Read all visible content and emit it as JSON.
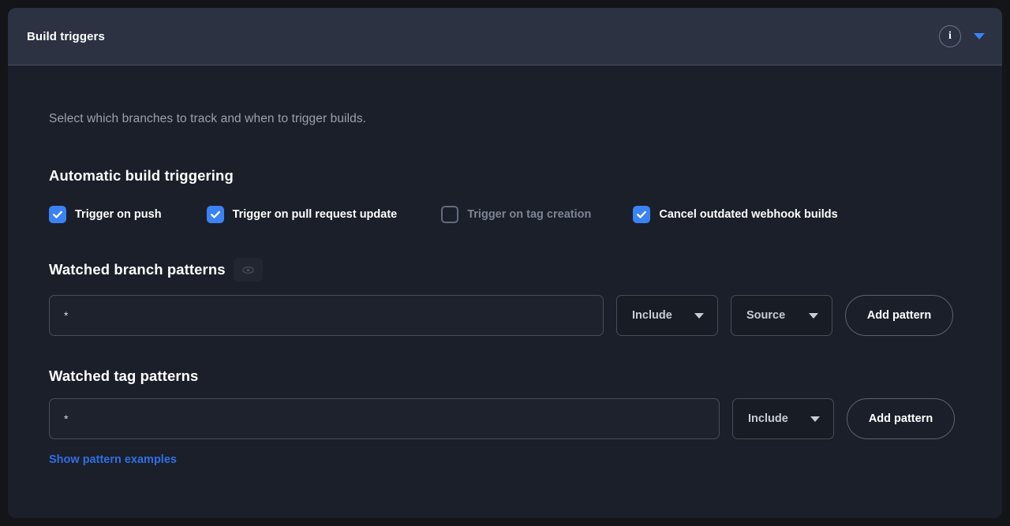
{
  "header": {
    "title": "Build triggers",
    "info_icon": "info-icon",
    "collapse_icon": "chevron-down-icon"
  },
  "body": {
    "intro": "Select which branches to track and when to trigger builds.",
    "automatic_section": {
      "heading": "Automatic build triggering",
      "checkboxes": [
        {
          "label": "Trigger on push",
          "checked": true,
          "disabled": false
        },
        {
          "label": "Trigger on pull request update",
          "checked": true,
          "disabled": false
        },
        {
          "label": "Trigger on tag creation",
          "checked": false,
          "disabled": true
        },
        {
          "label": "Cancel outdated webhook builds",
          "checked": true,
          "disabled": false
        }
      ]
    },
    "branch_section": {
      "heading": "Watched branch patterns",
      "visibility_icon": "eye-icon",
      "input_value": "*",
      "input_placeholder": "*",
      "include_select": "Include",
      "source_select": "Source",
      "add_button": "Add pattern"
    },
    "tag_section": {
      "heading": "Watched tag patterns",
      "input_value": "*",
      "input_placeholder": "*",
      "include_select": "Include",
      "add_button": "Add pattern",
      "examples_link": "Show pattern examples"
    }
  },
  "colors": {
    "page_background": "#141519",
    "card_background": "#1b1f29",
    "header_background": "#2c3242",
    "accent_blue": "#3b82f6",
    "link_blue": "#2f6fe4",
    "muted_text": "#9aa1b0",
    "disabled_text": "#7d8595",
    "border": "#474d5c"
  }
}
